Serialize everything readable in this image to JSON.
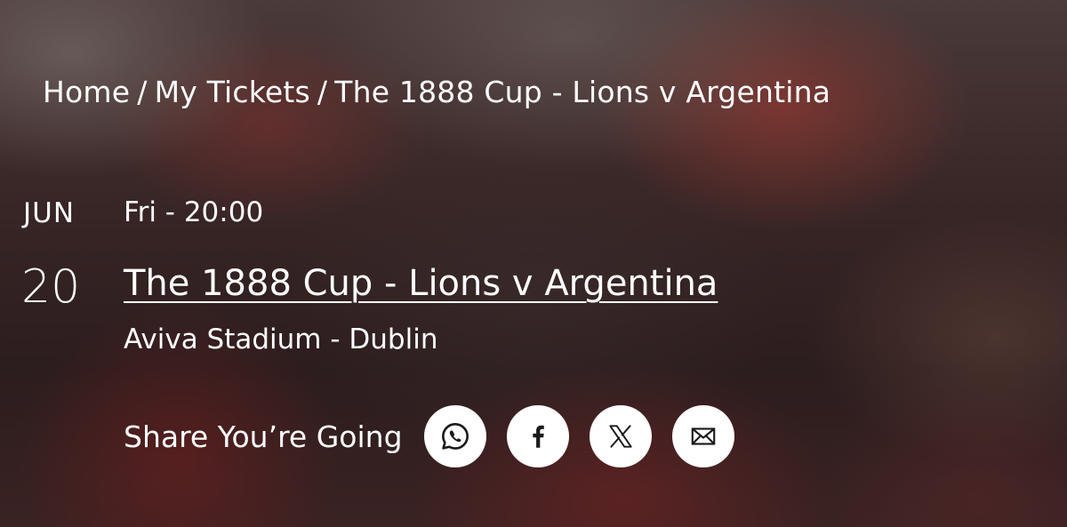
{
  "breadcrumb": {
    "items": [
      "Home",
      "My Tickets",
      "The 1888 Cup - Lions v Argentina"
    ],
    "separator": "/"
  },
  "event": {
    "month": "JUN",
    "day": "20",
    "weekday_time": "Fri - 20:00",
    "title": "The 1888 Cup - Lions v Argentina",
    "venue": "Aviva Stadium - Dublin"
  },
  "share": {
    "label": "Share You’re Going",
    "buttons": [
      {
        "icon": "whatsapp-icon"
      },
      {
        "icon": "facebook-icon"
      },
      {
        "icon": "x-icon"
      },
      {
        "icon": "email-icon"
      }
    ]
  },
  "colors": {
    "text": "#ffffff",
    "icon": "#1a1a1a",
    "button_bg": "#ffffff"
  }
}
